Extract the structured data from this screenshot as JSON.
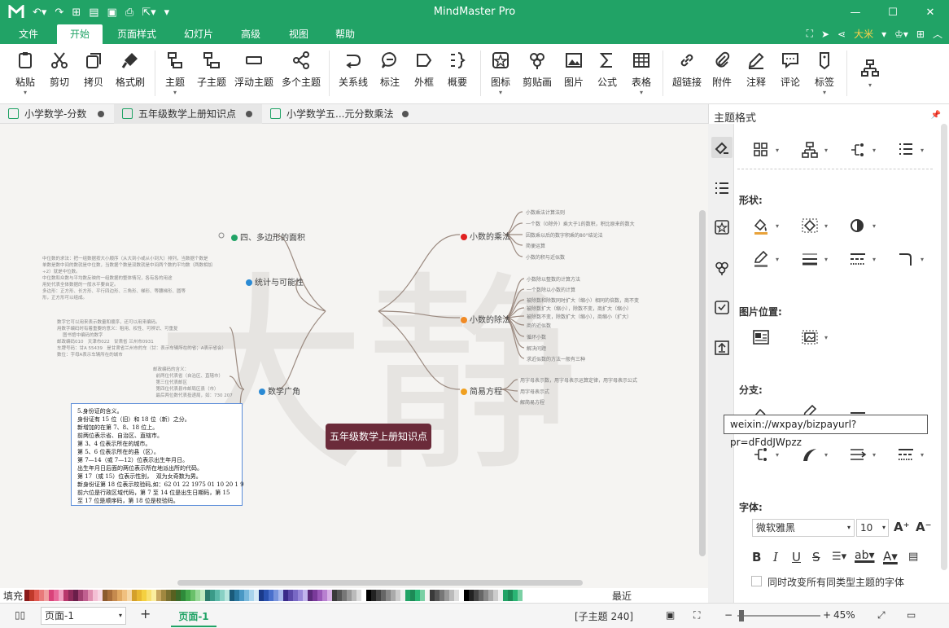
{
  "app": {
    "title": "MindMaster Pro",
    "user": "大米",
    "quick_access": [
      "undo-icon",
      "redo-icon",
      "new-icon",
      "open-icon",
      "save-icon",
      "print-icon",
      "export-icon"
    ]
  },
  "window_controls": [
    "minimize",
    "maximize",
    "close"
  ],
  "menu": {
    "items": [
      "文件",
      "开始",
      "页面样式",
      "幻灯片",
      "高级",
      "视图",
      "帮助"
    ],
    "active": "开始"
  },
  "ribbon": {
    "buttons": [
      {
        "label": "粘贴",
        "icon": "paste-icon",
        "dropdown": true
      },
      {
        "label": "剪切",
        "icon": "cut-icon"
      },
      {
        "label": "拷贝",
        "icon": "copy-icon"
      },
      {
        "label": "格式刷",
        "icon": "format-painter-icon"
      },
      {
        "label": "主题",
        "icon": "topic-icon",
        "dropdown": true
      },
      {
        "label": "子主题",
        "icon": "subtopic-icon"
      },
      {
        "label": "浮动主题",
        "icon": "floating-topic-icon"
      },
      {
        "label": "多个主题",
        "icon": "multiple-topics-icon"
      },
      {
        "label": "关系线",
        "icon": "relationship-icon"
      },
      {
        "label": "标注",
        "icon": "callout-icon"
      },
      {
        "label": "外框",
        "icon": "boundary-icon"
      },
      {
        "label": "概要",
        "icon": "summary-icon"
      },
      {
        "label": "图标",
        "icon": "icon-icon",
        "dropdown": true
      },
      {
        "label": "剪贴画",
        "icon": "clipart-icon"
      },
      {
        "label": "图片",
        "icon": "picture-icon"
      },
      {
        "label": "公式",
        "icon": "formula-icon"
      },
      {
        "label": "表格",
        "icon": "table-icon",
        "dropdown": true
      },
      {
        "label": "超链接",
        "icon": "hyperlink-icon"
      },
      {
        "label": "附件",
        "icon": "attachment-icon"
      },
      {
        "label": "注释",
        "icon": "note-icon"
      },
      {
        "label": "评论",
        "icon": "comment-icon"
      },
      {
        "label": "标签",
        "icon": "tag-icon",
        "dropdown": true
      },
      {
        "label": "",
        "icon": "layout-icon",
        "dropdown": true
      }
    ]
  },
  "tabs": [
    {
      "label": "小学数学-分数"
    },
    {
      "label": "五年级数学上册知识点",
      "active": true
    },
    {
      "label": "小学数学五...元分数乘法"
    }
  ],
  "mindmap": {
    "central": "五年级数学上册知识点",
    "right_topics": [
      {
        "label": "小数的乘法",
        "color": "#e02020",
        "subs": [
          "小数乘法计算法则",
          "一个数（0除外）乘大于1的数积，积比原来的数大",
          "因数乘以后的数字积乘的80°结论法",
          "简便运算",
          "小数的积与近似数"
        ]
      },
      {
        "label": "小数的除法",
        "color": "#f08a24",
        "subs": [
          "小数除以整数的计算方法",
          "一个数除以小数的计算",
          "被除数和除数同时扩大（缩小）相同的倍数，商不变",
          "被除数扩大（缩小），除数不变，商扩大（缩小）",
          "被除数不变，除数扩大（缩小），商缩小（扩大）",
          "商的近似数",
          "循环小数",
          "解决问题",
          "求近似数的方法一般有三种"
        ]
      },
      {
        "label": "简易方程",
        "color": "#f0a020",
        "subs": [
          "用字母表示数，用字母表示运算定律，用字母表示公式",
          "用字母表示式",
          "解简易方程"
        ]
      }
    ],
    "left_topics": [
      {
        "label": "四、多边形的面积",
        "color": "#21a366"
      },
      {
        "label": "统计与可能性",
        "color": "#2a8ad4"
      },
      {
        "label": "数学广角",
        "color": "#2a8ad4"
      }
    ],
    "stat_note": "中位数的求法：把一组数据按大小顺序（从大到小或从小到大）排列，当数据个数是\n单数是数中间的数就是中位数，当数据个数是双数就是中间两个数的平均数（两数相加\n÷2）就是中位数。\n中位数和众数与平均数反映的一组数据的整体情况，各有各的用途\n用处代表全体数据的一般水平要自定。\n多边形：正方形、长方形、平行四边形、三角形、梯形、等腰梯形、圆等\n形，正方形可以组成。",
    "guangjiao_note1": "数字它可以用来表示数量和顺序，还可以用来编码。\n用数字编码时有着重要的意义：租用、权性、可辨识、可重复\n    图书馆中编码的数字\n邮政编码010   天津市022   甘肃省 兰州市0931\n车牌号码：甘A 55439   是甘肃省兰州市的车（甘：表示车辆所在的省；A表示省会）\n数位：字母A表示车辆所在的城市",
    "guangjiao_note2": "邮政编码的含义：\n  前两位代表省（自治区、直辖市）\n  第三位代表邮区\n  第四位代表县市邮局区县（市）\n  最后两位数代表投递局，如：730 207",
    "idcard": "5.身份证的含义。\n身份证有 15 位（旧）和 18 位（新）之分。\n新增加的在第 7、8、18 位上。\n前两位表示省、自治区、直辖市。\n第 3、4 位表示所在的城市。\n第 5、6 位表示所在的县（区）。\n第 7—14（或 7—12）位表示出生年月日。\n出生年月日后面的两位表示所在地派出所的代码。\n第 17（或 15）位表示性别，  双为女奇数为男。\n新身份证第 18 位表示校验码,如：62 01 22 1975 01 10 20 1 9\n前六位是行政区域代码，第 7 至 14 位是出生日期码，第 15\n至 17 位是顺序码，第 18 位是校验码。"
  },
  "colorbar": {
    "label": "填充",
    "recent_label": "最近",
    "colors": [
      "#8b1a1a",
      "#c0392b",
      "#e0584f",
      "#e87a7a",
      "#f0a0a0",
      "#d9437a",
      "#e86a9a",
      "#f0a0c0",
      "#b8386c",
      "#8e2a5a",
      "#6a1e4a",
      "#a04070",
      "#c06090",
      "#e090b0",
      "#f4c0d4",
      "#f7d8e4",
      "#8c5a2e",
      "#a86d3a",
      "#c58a4e",
      "#e0a862",
      "#f0c080",
      "#f6d8a8",
      "#d4a02a",
      "#e8b830",
      "#f4d040",
      "#f8e070",
      "#fbee9e",
      "#c8a860",
      "#a08840",
      "#787030",
      "#586020",
      "#3a6a2a",
      "#2e8a3a",
      "#44a84c",
      "#6ac06a",
      "#98d898",
      "#c0eac0",
      "#2a7a6a",
      "#3a9a88",
      "#5ab8a8",
      "#88d0c4",
      "#b8e6de",
      "#1a5a7a",
      "#2a78a0",
      "#4a98c4",
      "#78b8dc",
      "#a8d4ec",
      "#d4eaf6",
      "#1a3a8a",
      "#2a52b0",
      "#4a70cc",
      "#7894dc",
      "#a8b8ec",
      "#3a2a8a",
      "#5a48a8",
      "#7868c4",
      "#9888d8",
      "#c0b4ec",
      "#5a2a7a",
      "#7a3a9a",
      "#9a58b8",
      "#b880d0",
      "#d8b0e6",
      "#3a3a3a",
      "#555555",
      "#777777",
      "#999999",
      "#bbbbbb",
      "#dddddd",
      "#ffffff",
      "#000000",
      "#222222",
      "#444444",
      "#666666",
      "#888888",
      "#aaaaaa",
      "#cccccc",
      "#eeeeee",
      "#21a366",
      "#1d8a56",
      "#2ab574",
      "#7ad0a4",
      "#f5f4f2",
      "#3a3a3a",
      "#555555",
      "#777777",
      "#999999",
      "#bbbbbb",
      "#dddddd",
      "#ffffff",
      "#000000",
      "#222222",
      "#444444",
      "#666666",
      "#888888",
      "#aaaaaa",
      "#cccccc",
      "#eeeeee",
      "#21a366",
      "#1d8a56",
      "#2ab574",
      "#7ad0a4"
    ]
  },
  "statusbar": {
    "page_select": "页面-1",
    "page_tab": "页面-1",
    "subtopic_count": "[子主题 240]",
    "zoom": "45%"
  },
  "panel": {
    "title": "主题格式",
    "shape_label": "形状:",
    "image_pos_label": "图片位置:",
    "branch_label": "分支:",
    "font_label": "字体:",
    "font_family": "微软雅黑",
    "font_size": "10",
    "checkbox_label": "同时改变所有同类型主题的字体"
  },
  "tooltip": "weixin://wxpay/bizpayurl?pr=dFddJWpzz",
  "watermark": "大静"
}
